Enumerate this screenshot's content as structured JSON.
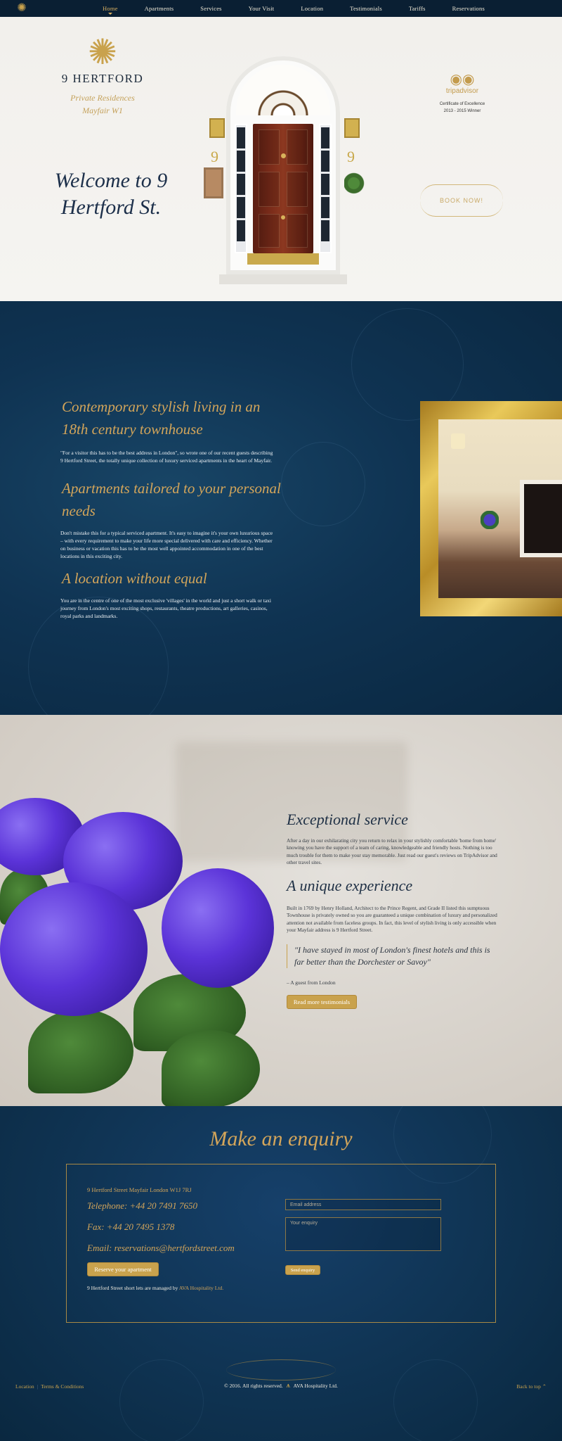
{
  "nav": {
    "logo_icon": "sun-logo-icon",
    "items": [
      {
        "label": "Home",
        "active": true
      },
      {
        "label": "Apartments"
      },
      {
        "label": "Services"
      },
      {
        "label": "Your Visit"
      },
      {
        "label": "Location"
      },
      {
        "label": "Testimonials"
      },
      {
        "label": "Tariffs"
      },
      {
        "label": "Reservations"
      }
    ]
  },
  "hero": {
    "brand_name": "9 HERTFORD",
    "brand_sub1": "Private Residences",
    "brand_sub2": "Mayfair W1",
    "welcome": "Welcome to 9 Hertford St.",
    "house_number": "9",
    "tripadvisor": {
      "name": "tripadvisor",
      "certificate": "Certificate of Excellence",
      "years": "2013 - 2015 Winner"
    },
    "book_now": "BOOK NOW!"
  },
  "about": {
    "h1": "Contemporary stylish living in an 18th century townhouse",
    "p1": "\"For a visitor this has to be the best address in London\", so wrote one of our recent guests describing 9 Hertford Street, the totally unique collection of luxury serviced apartments in the heart of Mayfair.",
    "h2": "Apartments tailored to your personal needs",
    "p2": "Don't mistake this for a typical serviced apartment. It's easy to imagine it's your own luxurious space – with every requirement to make your life more special delivered with care and efficiency. Whether on business or vacation this has to be the most well appointed accommodation in one of the best locations in this exciting city.",
    "h3": "A location without equal",
    "p3": "You are in the centre of one of the most exclusive 'villages' in the world and just a short walk or taxi journey from London's most exciting shops, restaurants, theatre productions, art galleries, casinos, royal parks and landmarks."
  },
  "service": {
    "h1": "Exceptional service",
    "p1": "After a day in our exhilarating city you return to relax in your stylishly comfortable 'home from home' knowing you have the support of a team of caring, knowledgeable and friendly hosts. Nothing is too much trouble for them to make your stay memorable. Just read our guest's reviews on TripAdvisor and other travel sites.",
    "h2": "A unique experience",
    "p2": "Built in 1769 by Henry Holland, Architect to the Prince Regent, and Grade II listed this sumptuous Townhouse is privately owned so you are guaranteed a unique combination of luxury and personalized attention not available from faceless groups. In fact, this level of stylish living is only accessible when your Mayfair address is 9 Hertford Street.",
    "quote": "\"I have stayed in most of London's finest hotels and this is far better than the Dorchester or Savoy\"",
    "quote_by": "– A guest from London",
    "testimonials_btn": "Read more testimonials"
  },
  "enquiry": {
    "title": "Make an enquiry",
    "address": "9 Hertford Street Mayfair London W1J 7RJ",
    "telephone": "Telephone: +44 20 7491 7650",
    "fax": "Fax: +44 20 7495 1378",
    "email": "Email: reservations@hertfordstreet.com",
    "reserve_btn": "Reserve your apartment",
    "managed_prefix": "9 Hertford Street short lets are managed by",
    "managed_company": "AVA Hospitality Ltd.",
    "email_placeholder": "Email address",
    "enquiry_placeholder": "Your enquiry",
    "send_btn": "Send enquiry"
  },
  "footer": {
    "link1": "Location",
    "sep": "|",
    "link2": "Terms & Conditions",
    "copyright_prefix": "© 2016. All rights reserved.",
    "ava_logo": "ava-logo-icon",
    "copyright_company": "AVA Hospitality Ltd.",
    "back_to_top": "Back to top ⌃"
  },
  "colors": {
    "gold": "#c9a24d",
    "navy": "#0f3352",
    "nav_bg": "#0a1f33"
  }
}
